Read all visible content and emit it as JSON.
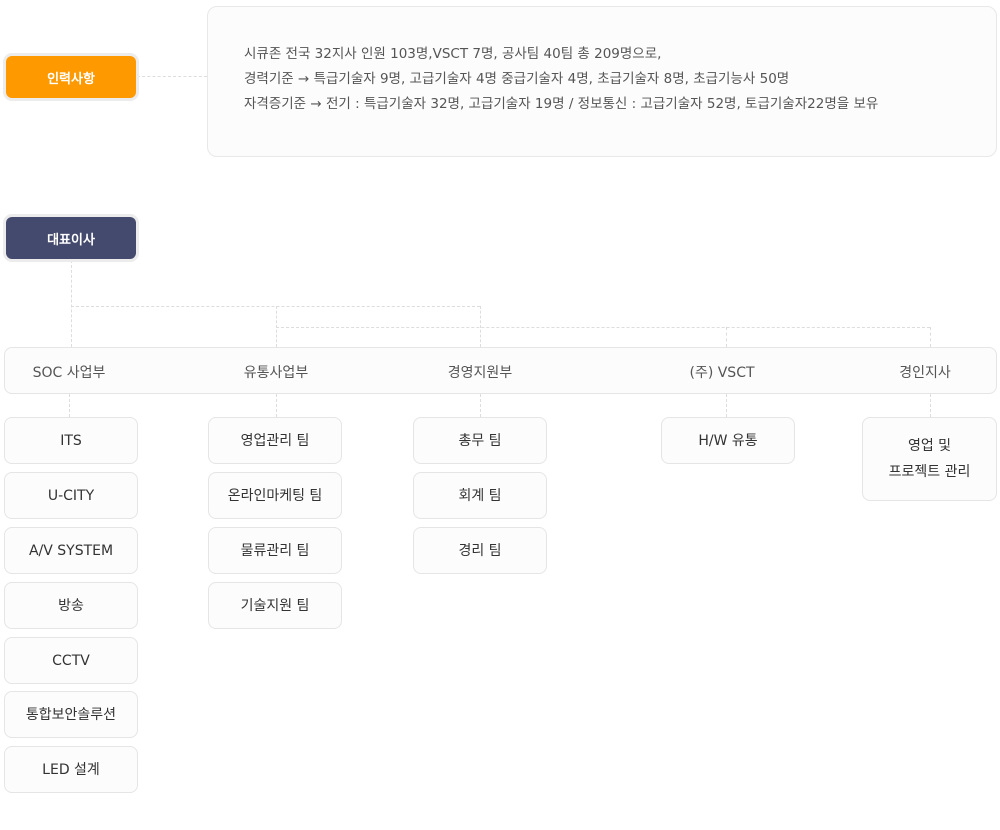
{
  "staff": {
    "label": "인력사항",
    "color": "#ff9900",
    "lines": [
      "시큐존 전국 32지사 인원 103명,VSCT 7명, 공사팀 40팀 총 209명으로,",
      "경력기준 → 특급기술자 9명, 고급기술자 4명 중급기술자 4명, 초급기술자 8명, 초급기능사 50명",
      "자격증기준 → 전기 : 특급기술자 32명, 고급기술자 19명 / 정보통신 : 고급기술자 52명, 토급기술자22명을 보유"
    ]
  },
  "ceo": {
    "label": "대표이사",
    "color": "#444a6e"
  },
  "departments": [
    {
      "name": "SOC 사업부",
      "teams": [
        "ITS",
        "U-CITY",
        "A/V SYSTEM",
        "방송",
        "CCTV",
        "통합보안솔루션",
        "LED 설계"
      ]
    },
    {
      "name": "유통사업부",
      "teams": [
        "영업관리 팀",
        "온라인마케팅 팀",
        "물류관리 팀",
        "기술지원 팀"
      ]
    },
    {
      "name": "경영지원부",
      "teams": [
        "총무 팀",
        "회계 팀",
        "경리 팀"
      ]
    },
    {
      "name": "(주) VSCT",
      "teams": [
        "H/W 유통"
      ]
    },
    {
      "name": "경인지사",
      "teams": [
        [
          "영업 및",
          "프로젝트 관리"
        ]
      ]
    }
  ]
}
